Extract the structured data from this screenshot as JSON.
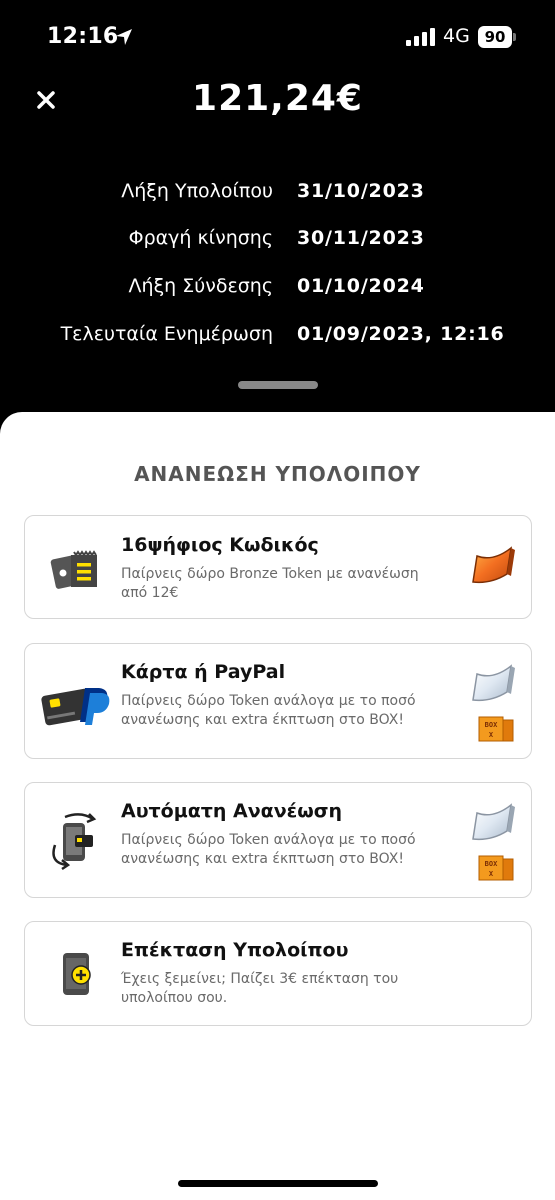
{
  "status_bar": {
    "time": "12:16",
    "network": "4G",
    "battery": "90"
  },
  "header": {
    "balance": "121,24€"
  },
  "info": [
    {
      "label": "Λήξη Υπολοίπου",
      "value": "31/10/2023"
    },
    {
      "label": "Φραγή κίνησης",
      "value": "30/11/2023"
    },
    {
      "label": "Λήξη Σύνδεσης",
      "value": "01/10/2024"
    },
    {
      "label": "Τελευταία Ενημέρωση",
      "value": "01/09/2023, 12:16"
    }
  ],
  "section_title": "ΑΝΑΝΕΩΣΗ ΥΠΟΛΟΙΠΟΥ",
  "cards": [
    {
      "title": "16ψήφιος Κωδικός",
      "desc": "Παίρνεις δώρο Bronze Token με ανανέωση από 12€"
    },
    {
      "title": "Κάρτα ή PayPal",
      "desc": "Παίρνεις δώρο Token ανάλογα με το ποσό ανανέωσης και extra έκπτωση στο BOX!"
    },
    {
      "title": "Αυτόματη Ανανέωση",
      "desc": "Παίρνεις δώρο Token ανάλογα με το ποσό ανανέωσης και extra έκπτωση στο BOX!"
    },
    {
      "title": "Επέκταση Υπολοίπου",
      "desc": "Έχεις ξεμείνει; Παίζει 3€ επέκταση του υπολοίπου σου."
    }
  ],
  "box_badge": {
    "top": "BOX",
    "bottom": "X"
  },
  "colors": {
    "accent_orange": "#F36F21",
    "accent_yellow": "#FFE000",
    "paypal_blue": "#1D7FD9",
    "paypal_dark": "#003087",
    "background_dark": "#000000"
  },
  "icons": [
    "close-icon",
    "location-arrow-icon",
    "signal-icon",
    "voucher-icon",
    "card-paypal-icon",
    "auto-renew-phone-icon",
    "phone-plus-icon",
    "bronze-token-icon",
    "silver-token-icon",
    "box-icon"
  ]
}
